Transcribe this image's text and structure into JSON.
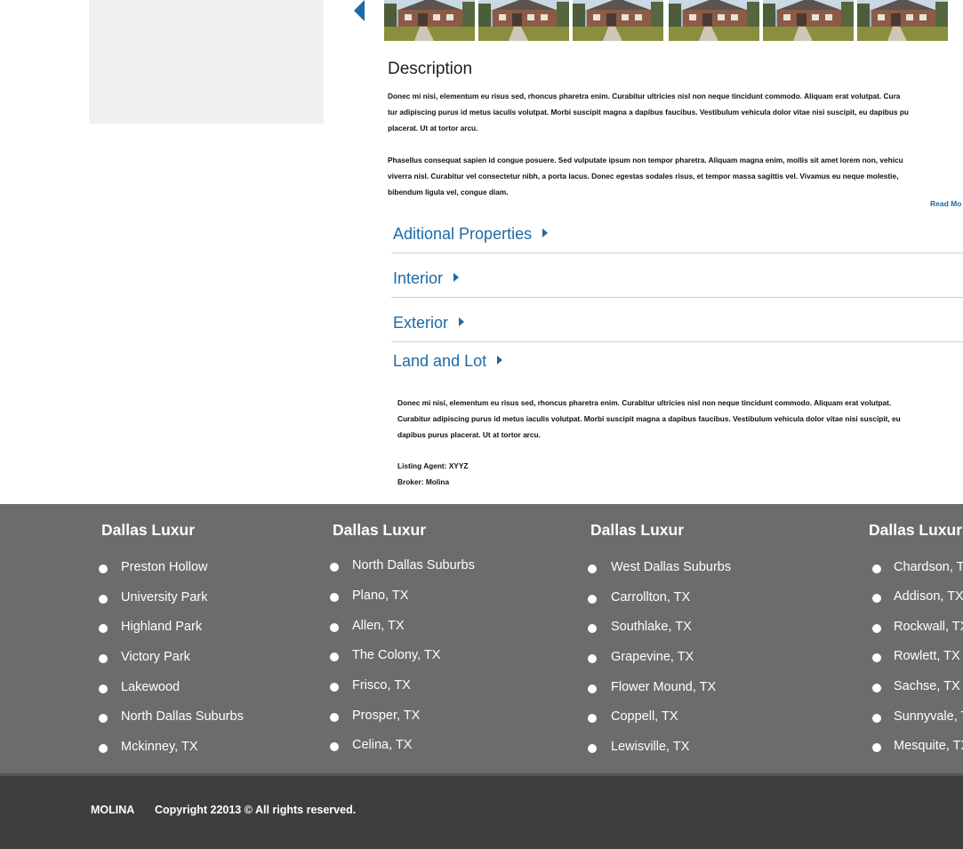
{
  "gallery": {
    "prev_label": "Previous photo",
    "thumbnails": [
      "house-photo-1",
      "house-photo-2",
      "house-photo-3",
      "house-photo-4",
      "house-photo-5",
      "house-photo-6"
    ]
  },
  "description": {
    "title": "Description",
    "para1": [
      "Donec mi nisi, elementum eu risus sed, rhoncus pharetra enim. Curabitur ultricies nisl non neque tincidunt commodo. Aliquam erat volutpat. Cura",
      "tur adipiscing purus id metus iaculis volutpat. Morbi suscipit magna a dapibus faucibus. Vestibulum vehicula dolor vitae nisi suscipit, eu dapibus pu",
      "placerat. Ut at tortor arcu."
    ],
    "para2": [
      "Phasellus consequat sapien id congue posuere. Sed vulputate ipsum non tempor pharetra. Aliquam magna enim, mollis sit amet lorem non, vehicu",
      "viverra nisl. Curabitur vel consectetur nibh, a porta lacus. Donec egestas sodales risus, et tempor massa sagittis vel. Vivamus eu neque molestie,",
      "bibendum ligula vel, congue diam."
    ],
    "read_more": "Read Mo"
  },
  "accordion": {
    "additional": "Aditional Properties",
    "interior": "Interior",
    "exterior": "Exterior",
    "land": "Land and Lot"
  },
  "land_lot": {
    "text": [
      "Donec mi nisi, elementum eu risus sed, rhoncus pharetra enim. Curabitur ultricies nisl non neque tincidunt commodo. Aliquam erat volutpat.",
      "Curabitur adipiscing purus id metus iaculis volutpat. Morbi suscipit magna a dapibus faucibus. Vestibulum vehicula dolor vitae nisi suscipit, eu",
      "dapibus purus placerat. Ut at tortor arcu."
    ],
    "agent": "Listing Agent: XYYZ",
    "broker": "Broker:  Molina"
  },
  "footer": {
    "columns": [
      {
        "title": "Dallas Luxur",
        "items": [
          "Preston Hollow",
          "University Park",
          " Highland Park",
          "Victory Park",
          "Lakewood",
          "North Dallas Suburbs",
          "Mckinney, TX"
        ]
      },
      {
        "title": "Dallas Luxur",
        "items": [
          "North Dallas Suburbs",
          "Plano, TX",
          "Allen, TX",
          "The Colony, TX",
          "Frisco, TX",
          "Prosper, TX",
          "Celina, TX"
        ]
      },
      {
        "title": "Dallas Luxur",
        "items": [
          "West Dallas Suburbs",
          "Carrollton, TX",
          "Southlake, TX",
          "Grapevine, TX",
          "Flower Mound, TX",
          "Coppell, TX",
          "Lewisville, TX"
        ]
      },
      {
        "title": "Dallas Luxur",
        "items": [
          "Chardson, T",
          "Addison, TX",
          "Rockwall, TX",
          "Rowlett, TX",
          "Sachse, TX",
          "Sunnyvale, T",
          "Mesquite, TX"
        ]
      }
    ],
    "brand": "MOLINA",
    "copyright": "Copyright 22013  © All rights reserved."
  },
  "colors": {
    "accent": "#1c6aa6",
    "footer_bg": "#6c6c6c",
    "footer_bottom_bg": "#3e3e3e"
  }
}
